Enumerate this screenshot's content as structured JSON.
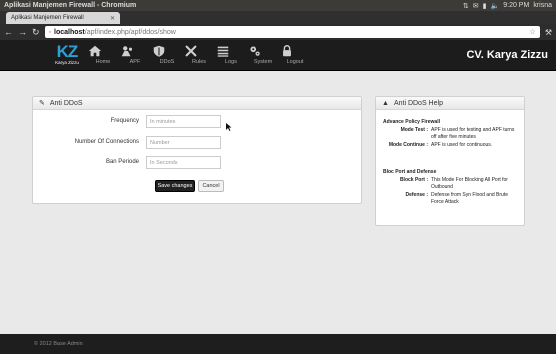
{
  "os": {
    "window_title": "Aplikasi Manjemen Firewall - Chromium",
    "clock": "9:20 PM",
    "user": "krisna"
  },
  "browser": {
    "tab_title": "Aplikasi Manjemen Firewall",
    "url_host": "localhost",
    "url_path": "/apf/index.php/apf/ddos/show"
  },
  "navbar": {
    "brand_main": "KZ",
    "brand_sub": "Karya Zizzu",
    "company": "CV. Karya Zizzu",
    "items": [
      {
        "label": "Home",
        "icon": "home-icon"
      },
      {
        "label": "APF",
        "icon": "apf-icon"
      },
      {
        "label": "DDoS",
        "icon": "shield-icon"
      },
      {
        "label": "Rules",
        "icon": "rules-icon"
      },
      {
        "label": "Logs",
        "icon": "list-icon"
      },
      {
        "label": "System",
        "icon": "gears-icon"
      },
      {
        "label": "Logout",
        "icon": "lock-icon"
      }
    ]
  },
  "anti_ddos": {
    "title": "Anti DDoS",
    "fields": [
      {
        "label": "Frequency",
        "placeholder": "In minutes"
      },
      {
        "label": "Number Of Connections",
        "placeholder": "Number"
      },
      {
        "label": "Ban Periode",
        "placeholder": "In Seconds"
      }
    ],
    "save_label": "Save changes",
    "cancel_label": "Cancel"
  },
  "help": {
    "title": "Anti DDoS Help",
    "section1_title": "Advance Policy Firewall",
    "section1": [
      {
        "key": "Mode Test :",
        "value": "APF is used for testing and APF turns off after five minutes"
      },
      {
        "key": "Mode Continue :",
        "value": "APF is used for continuous."
      }
    ],
    "section2_title": "Bloc Port and Defense",
    "section2": [
      {
        "key": "Block Port :",
        "value": "This Mode For Blocking All Port for Outbound"
      },
      {
        "key": "Defense :",
        "value": "Defense from Syn Flood and Brute Force Attack"
      }
    ]
  },
  "footer": {
    "text": "© 2012 Base Admin"
  }
}
